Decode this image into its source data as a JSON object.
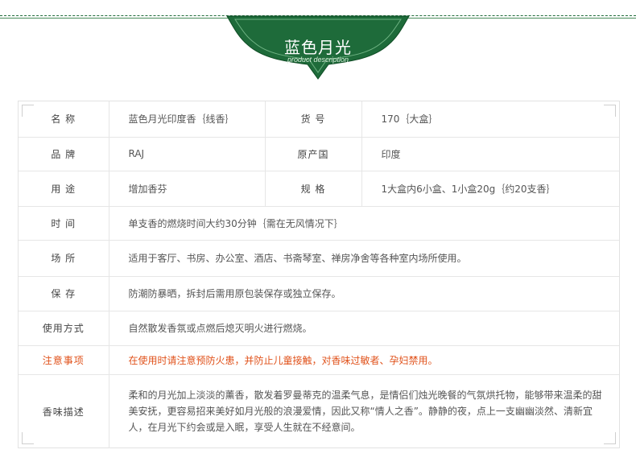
{
  "banner": {
    "title": "蓝色月光",
    "subtitle": "product description",
    "color": "#1e6b3a"
  },
  "specs": {
    "row1": {
      "label_a": "名  称",
      "value_a": "蓝色月光印度香｛线香｝",
      "label_b": "货  号",
      "value_b": "170｛大盒｝"
    },
    "row2": {
      "label_a": "品  牌",
      "value_a": "RAJ",
      "label_b": "原产国",
      "value_b": "印度"
    },
    "row3": {
      "label_a": "用  途",
      "value_a": "增加香芬",
      "label_b": "规  格",
      "value_b": "1大盒内6小盒、1小盒20g｛约20支香｝"
    },
    "time": {
      "label": "时  间",
      "value": "单支香的燃烧时间大约30分钟｛需在无风情况下｝"
    },
    "place": {
      "label": "场  所",
      "value": "适用于客厅、书房、办公室、酒店、书斋琴室、禅房净舍等各种室内场所使用。"
    },
    "storage": {
      "label": "保  存",
      "value": "防潮防暴晒，拆封后需用原包装保存或独立保存。"
    },
    "usage": {
      "label": "使用方式",
      "value": "自然散发香氛或点燃后熄灭明火进行燃烧。"
    },
    "caution": {
      "label": "注意事项",
      "value": "在使用时请注意预防火患，并防止儿童接触，对香味过敏者、孕妇禁用。",
      "color": "#e0521b"
    },
    "scent": {
      "label": "香味描述",
      "value": "柔和的月光加上淡淡的薰香，散发着罗曼蒂克的温柔气息，是情侣们烛光晚餐的气氛烘托物，能够带来温柔的甜美安抚，更容易招来美好如月光般的浪漫爱情，因此又称“情人之香”。静静的夜，点上一支幽幽淡然、清新宜人，在月光下约会或是入眠，享受人生就在不经意间。"
    }
  }
}
